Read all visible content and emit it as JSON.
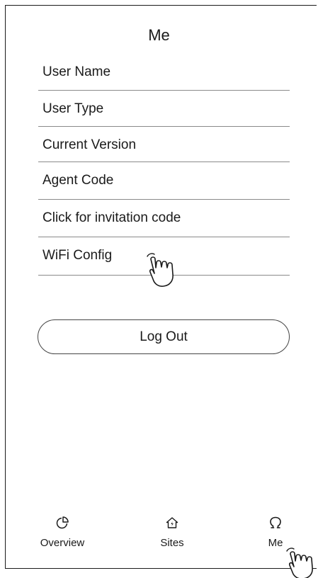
{
  "page": {
    "title": "Me"
  },
  "menu": {
    "items": [
      {
        "label": "User Name"
      },
      {
        "label": "User Type"
      },
      {
        "label": "Current Version"
      },
      {
        "label": "Agent Code"
      },
      {
        "label": "Click for invitation code"
      },
      {
        "label": "WiFi Config"
      }
    ]
  },
  "logout": {
    "label": "Log Out"
  },
  "tabbar": {
    "tabs": [
      {
        "label": "Overview",
        "icon": "pie-chart-icon"
      },
      {
        "label": "Sites",
        "icon": "house-bolt-icon"
      },
      {
        "label": "Me",
        "icon": "person-icon"
      }
    ]
  },
  "colors": {
    "text": "#1a1a1a",
    "divider": "#8a8a8a",
    "background": "#ffffff"
  }
}
